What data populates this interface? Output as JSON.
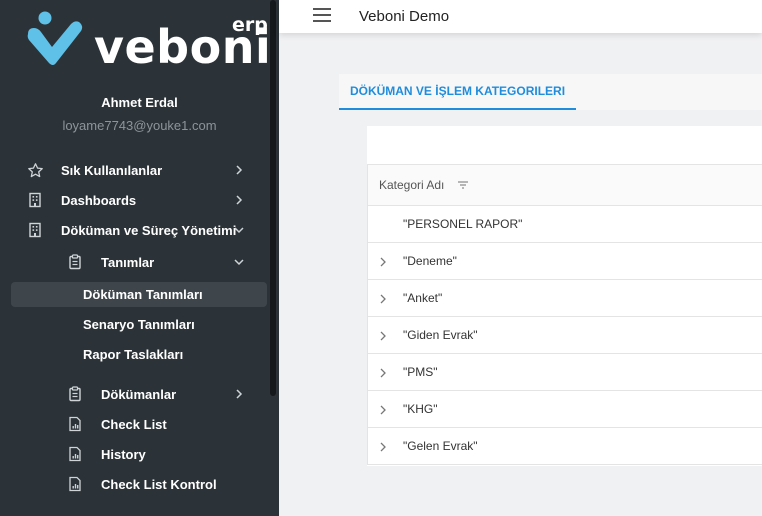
{
  "brand": {
    "word": "veboni",
    "suffix": "erp"
  },
  "user": {
    "name": "Ahmet Erdal",
    "email": "loyame7743@youke1.com"
  },
  "sidebar": {
    "items": [
      {
        "label": "Sık Kullanılanlar",
        "icon": "star-icon",
        "chevron": "right"
      },
      {
        "label": "Dashboards",
        "icon": "building-icon",
        "chevron": "right"
      },
      {
        "label": "Döküman ve Süreç Yönetimi",
        "icon": "building-icon",
        "chevron": "down"
      },
      {
        "label": "Tanımlar",
        "icon": "clipboard-icon",
        "chevron": "down"
      },
      {
        "label": "Döküman Tanımları",
        "active": true
      },
      {
        "label": "Senaryo Tanımları"
      },
      {
        "label": "Rapor Taslakları"
      },
      {
        "label": "Dökümanlar",
        "icon": "clipboard-icon",
        "chevron": "right"
      },
      {
        "label": "Check List",
        "icon": "report-icon"
      },
      {
        "label": "History",
        "icon": "report-icon"
      },
      {
        "label": "Check List Kontrol",
        "icon": "report-icon"
      }
    ]
  },
  "header": {
    "title": "Veboni Demo",
    "menu_icon": "hamburger-icon"
  },
  "tabs": [
    {
      "label": "DÖKÜMAN VE İŞLEM KATEGORILERI",
      "active": true
    }
  ],
  "table": {
    "columns": [
      "Kategori Adı"
    ],
    "rows": [
      {
        "name": "\"PERSONEL RAPOR\"",
        "expandable": false
      },
      {
        "name": "\"Deneme\"",
        "expandable": true
      },
      {
        "name": "\"Anket\"",
        "expandable": true
      },
      {
        "name": "\"Giden Evrak\"",
        "expandable": true
      },
      {
        "name": "\"PMS\"",
        "expandable": true
      },
      {
        "name": "\"KHG\"",
        "expandable": true
      },
      {
        "name": "\"Gelen Evrak\"",
        "expandable": true
      }
    ]
  },
  "colors": {
    "sidebar_bg": "#2c3338",
    "accent": "#1f8ddc",
    "active_item_bg": "#3e464c",
    "logo_blue": "#5fc0e8"
  }
}
